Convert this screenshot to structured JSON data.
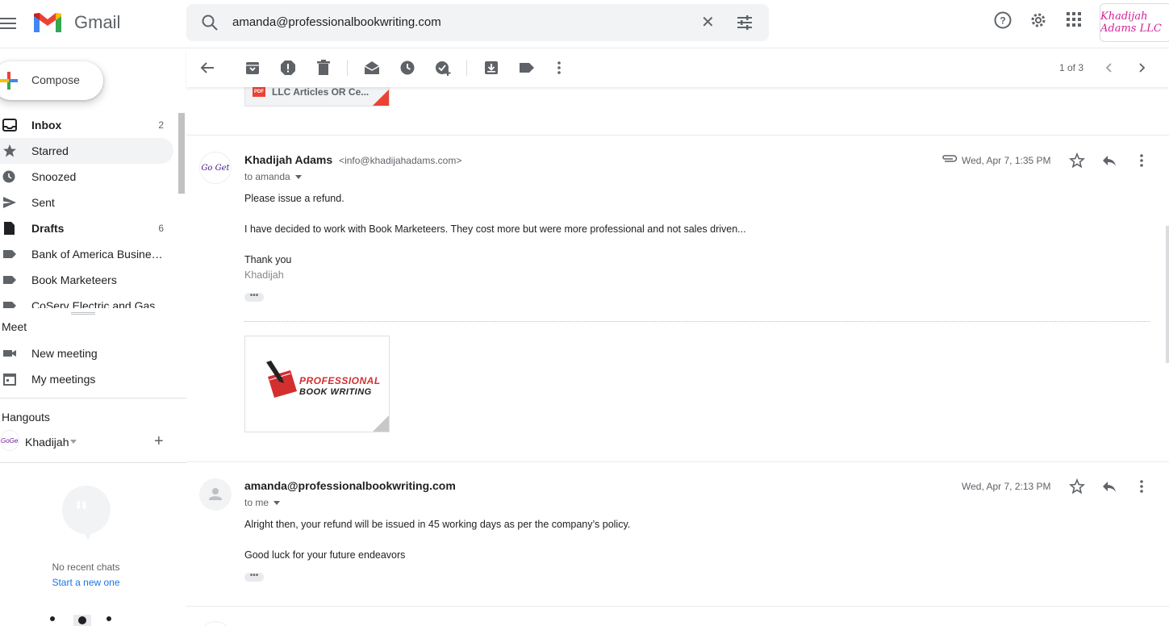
{
  "header": {
    "app_name": "Gmail",
    "search_value": "amanda@professionalbookwriting.com",
    "brand_label": "Khadijah Adams LLC",
    "icons": [
      "menu-icon",
      "gmail-logo",
      "search-icon",
      "clear-icon",
      "tune-icon",
      "help-icon",
      "settings-icon",
      "apps-icon"
    ]
  },
  "sidebar": {
    "compose_label": "Compose",
    "items": [
      {
        "label": "Inbox",
        "count": "2",
        "icon": "inbox-icon"
      },
      {
        "label": "Starred",
        "count": "",
        "icon": "star-icon"
      },
      {
        "label": "Snoozed",
        "count": "",
        "icon": "clock-icon"
      },
      {
        "label": "Sent",
        "count": "",
        "icon": "send-icon"
      },
      {
        "label": "Drafts",
        "count": "6",
        "icon": "draft-icon"
      },
      {
        "label": "Bank of America Busine…",
        "count": "",
        "icon": "label-icon"
      },
      {
        "label": "Book Marketeers",
        "count": "",
        "icon": "label-icon"
      },
      {
        "label": "CoServ Electric and Gas",
        "count": "",
        "icon": "label-icon"
      }
    ],
    "meet": {
      "title": "Meet",
      "new_meeting": "New meeting",
      "my_meetings": "My meetings"
    },
    "hangouts": {
      "title": "Hangouts",
      "user_name": "Khadijah",
      "no_chats": "No recent chats",
      "start_new": "Start a new one"
    }
  },
  "toolbar": {
    "pager": "1 of 3"
  },
  "thread": {
    "attachment_top_name": "LLC Articles OR Ce...",
    "messages": [
      {
        "sender": "Khadijah Adams",
        "sender_email": "<info@khadijahadams.com>",
        "to": "to amanda",
        "date": "Wed, Apr 7, 1:35 PM",
        "avatar_text": "Go Get That Money",
        "body": [
          "Please issue a refund.",
          "I have decided to work with Book Marketeers. They cost more but were more professional and not sales driven...",
          "Thank you"
        ],
        "signature": "Khadijah",
        "attachment_line1": "PROFESSIONAL",
        "attachment_line2": "BOOK WRITING"
      },
      {
        "sender": "amanda@professionalbookwriting.com",
        "to": "to me",
        "date": "Wed, Apr 7, 2:13 PM",
        "body": [
          "Alright then, your refund will be issued in 45 working days as per the company’s policy.",
          "Good luck for your future endeavors"
        ]
      }
    ]
  },
  "colors": {
    "accent_red": "#ea4335",
    "accent_blue": "#1a73e8",
    "active_item_bg": "#f1f3f4"
  }
}
